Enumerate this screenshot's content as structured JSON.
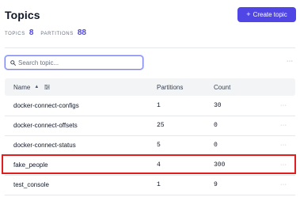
{
  "header": {
    "title": "Topics",
    "create_button_label": "Create topic",
    "create_button_icon": "+"
  },
  "stats": {
    "topics_label": "TOPICS",
    "topics_value": "8",
    "partitions_label": "PARTITIONS",
    "partitions_value": "88"
  },
  "search": {
    "placeholder": "Search topic...",
    "value": ""
  },
  "toolbar": {
    "more_label": "···"
  },
  "table": {
    "columns": {
      "name": "Name",
      "partitions": "Partitions",
      "count": "Count"
    },
    "sort_icon": "▲",
    "rows": [
      {
        "name": "docker-connect-configs",
        "partitions": "1",
        "count": "30",
        "more": "···"
      },
      {
        "name": "docker-connect-offsets",
        "partitions": "25",
        "count": "0",
        "more": "···"
      },
      {
        "name": "docker-connect-status",
        "partitions": "5",
        "count": "0",
        "more": "···"
      },
      {
        "name": "fake_people",
        "partitions": "4",
        "count": "300",
        "more": "···"
      },
      {
        "name": "test_console",
        "partitions": "1",
        "count": "9",
        "more": "···"
      }
    ]
  },
  "colors": {
    "accent": "#4f46e5",
    "highlight": "#e11d1d",
    "header_bg": "#f3f4f6"
  }
}
